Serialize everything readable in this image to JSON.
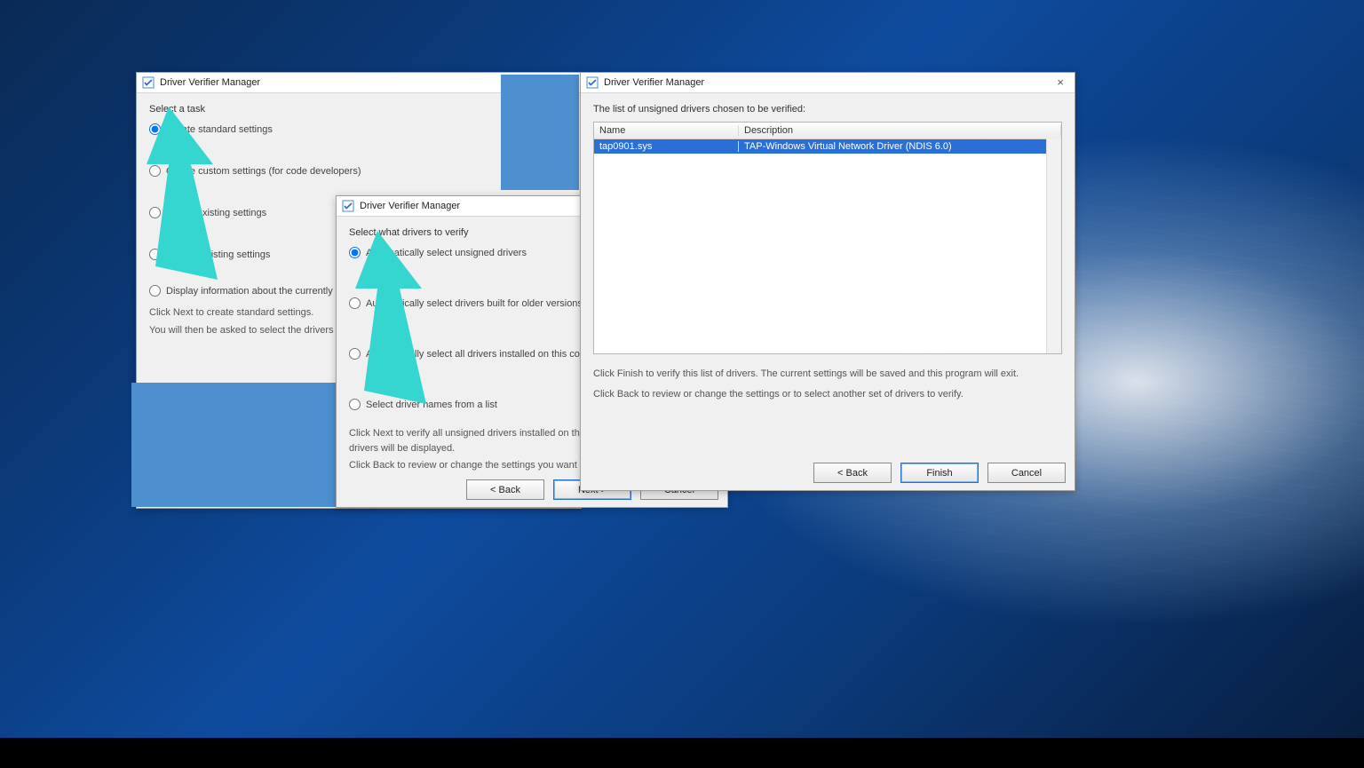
{
  "app_title": "Driver Verifier Manager",
  "win1": {
    "group": "Select a task",
    "opts": [
      "Create standard settings",
      "Create custom settings (for code developers)",
      "Delete existing settings",
      "Display existing settings",
      "Display information about the currently verified drivers"
    ],
    "hint1": "Click Next to create standard settings.",
    "hint2": "You will then be asked to select the drivers to verify."
  },
  "win2": {
    "group": "Select what drivers to verify",
    "opts": [
      "Automatically select unsigned drivers",
      "Automatically select drivers built for older versions of Windows",
      "Automatically select all drivers installed on this computer",
      "Select driver names from a list"
    ],
    "hint1": "Click Next to verify all unsigned drivers installed on this computer. A list of these drivers will be displayed.",
    "hint2": "Click Back to review or change the settings you want to create."
  },
  "win3": {
    "group": "The list of unsigned drivers chosen to be verified:",
    "cols": {
      "name": "Name",
      "desc": "Description"
    },
    "rows": [
      {
        "name": "tap0901.sys",
        "desc": "TAP-Windows Virtual Network Driver (NDIS 6.0)"
      }
    ],
    "hint1": "Click Finish to verify this list of drivers. The current settings will be saved and this program will exit.",
    "hint2": "Click Back to review or change the settings or to select another set of drivers to verify."
  },
  "buttons": {
    "back": "< Back",
    "next": "Next >",
    "finish": "Finish",
    "cancel": "Cancel"
  },
  "colors": {
    "arrow": "#36d6d0",
    "highlight": "#2a6fd6",
    "overlay": "#4d8fcf"
  }
}
